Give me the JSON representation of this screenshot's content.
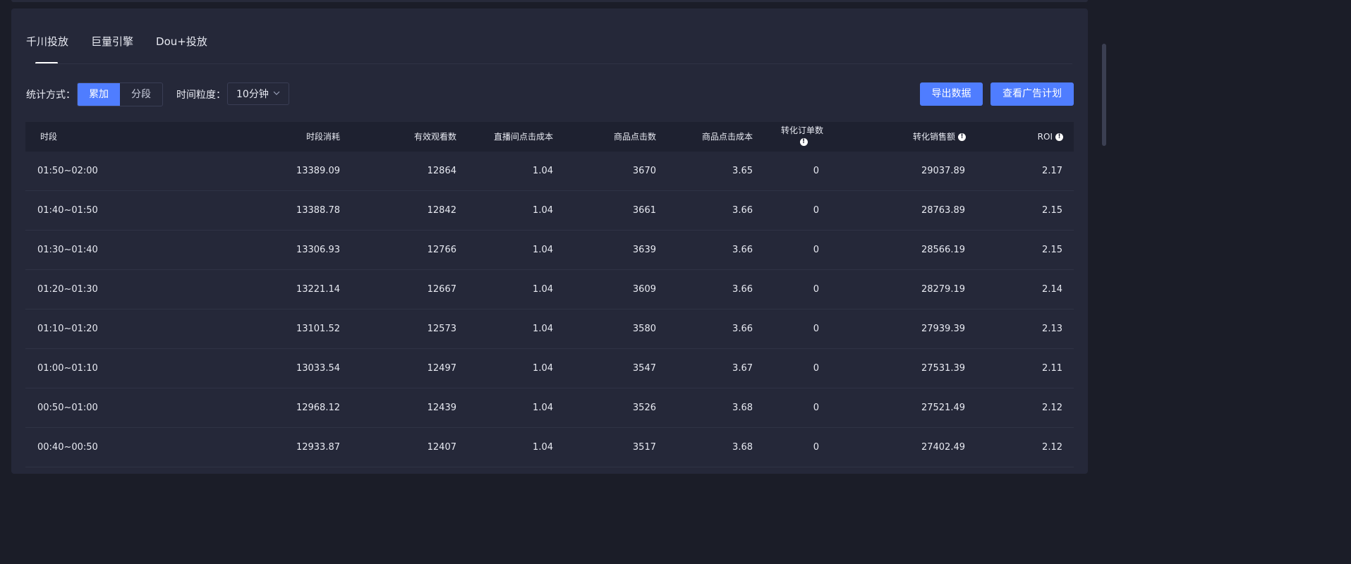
{
  "tabs": [
    "千川投放",
    "巨量引擎",
    "Dou+投放"
  ],
  "controls": {
    "stat_label": "统计方式：",
    "stat_options": [
      "累加",
      "分段"
    ],
    "granularity_label": "时间粒度：",
    "granularity_value": "10分钟"
  },
  "actions": {
    "export_label": "导出数据",
    "view_plan_label": "查看广告计划"
  },
  "table": {
    "headers": [
      "时段",
      "时段消耗",
      "有效观看数",
      "直播间点击成本",
      "商品点击数",
      "商品点击成本",
      "转化订单数",
      "转化销售额",
      "ROI"
    ],
    "rows": [
      [
        "01:50~02:00",
        "13389.09",
        "12864",
        "1.04",
        "3670",
        "3.65",
        "0",
        "29037.89",
        "2.17"
      ],
      [
        "01:40~01:50",
        "13388.78",
        "12842",
        "1.04",
        "3661",
        "3.66",
        "0",
        "28763.89",
        "2.15"
      ],
      [
        "01:30~01:40",
        "13306.93",
        "12766",
        "1.04",
        "3639",
        "3.66",
        "0",
        "28566.19",
        "2.15"
      ],
      [
        "01:20~01:30",
        "13221.14",
        "12667",
        "1.04",
        "3609",
        "3.66",
        "0",
        "28279.19",
        "2.14"
      ],
      [
        "01:10~01:20",
        "13101.52",
        "12573",
        "1.04",
        "3580",
        "3.66",
        "0",
        "27939.39",
        "2.13"
      ],
      [
        "01:00~01:10",
        "13033.54",
        "12497",
        "1.04",
        "3547",
        "3.67",
        "0",
        "27531.39",
        "2.11"
      ],
      [
        "00:50~01:00",
        "12968.12",
        "12439",
        "1.04",
        "3526",
        "3.68",
        "0",
        "27521.49",
        "2.12"
      ],
      [
        "00:40~00:50",
        "12933.87",
        "12407",
        "1.04",
        "3517",
        "3.68",
        "0",
        "27402.49",
        "2.12"
      ]
    ]
  },
  "colors": {
    "accent": "#4f7dff",
    "panel": "#252839",
    "background": "#1b1d28"
  },
  "icons": [
    "info-icon",
    "chevron-down-icon"
  ]
}
